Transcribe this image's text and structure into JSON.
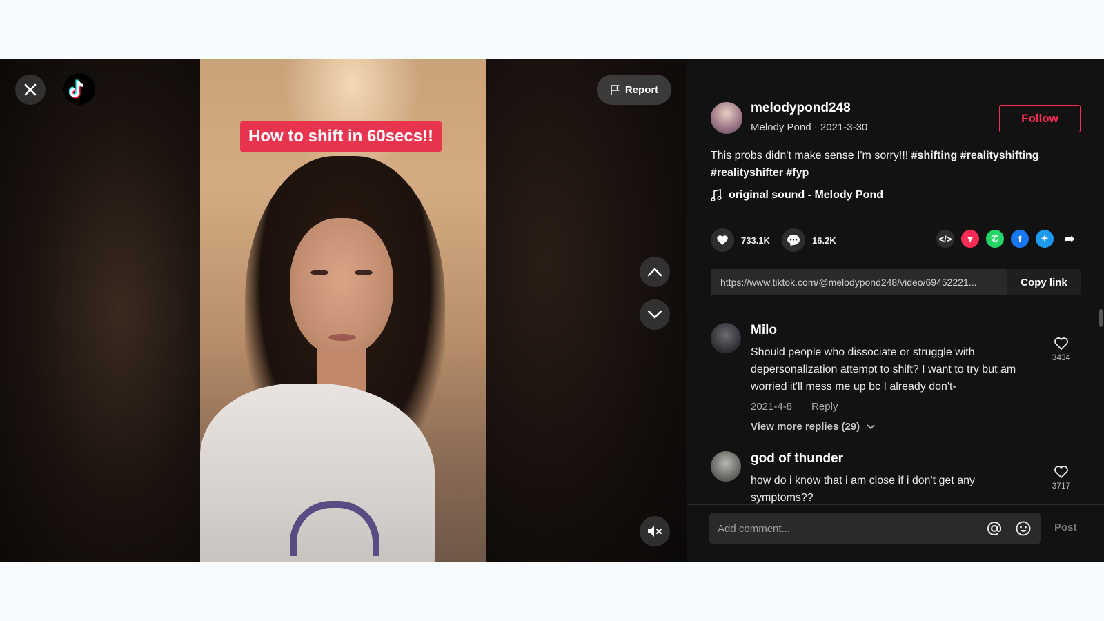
{
  "video": {
    "caption": "How to shift in 60secs!!",
    "report_label": "Report"
  },
  "author": {
    "username": "melodypond248",
    "meta": "Melody Pond · 2021-3-30",
    "follow_label": "Follow"
  },
  "description": {
    "text": "This probs didn't make sense I'm sorry!!! ",
    "tags": "#shifting #realityshifting #realityshifter #fyp"
  },
  "music": {
    "title": "original sound - Melody Pond"
  },
  "stats": {
    "likes": "733.1K",
    "comments": "16.2K"
  },
  "share": {
    "link": "https://www.tiktok.com/@melodypond248/video/69452221...",
    "copy_label": "Copy link"
  },
  "comments": [
    {
      "name": "Milo",
      "text": "Should people who dissociate or struggle with depersonalization attempt to shift? I want to try but am worried it'll mess me up bc I already don't-",
      "date": "2021-4-8",
      "reply_label": "Reply",
      "likes": "3434",
      "more_replies": "View more replies (29)"
    },
    {
      "name": "god of thunder",
      "text": "how do i know that i am close if i don't get any symptoms??",
      "likes": "3717"
    }
  ],
  "composer": {
    "placeholder": "Add comment...",
    "post_label": "Post"
  },
  "colors": {
    "accent": "#fe2c55",
    "caption_bg": "#e8344f",
    "panel_bg": "#121212"
  }
}
